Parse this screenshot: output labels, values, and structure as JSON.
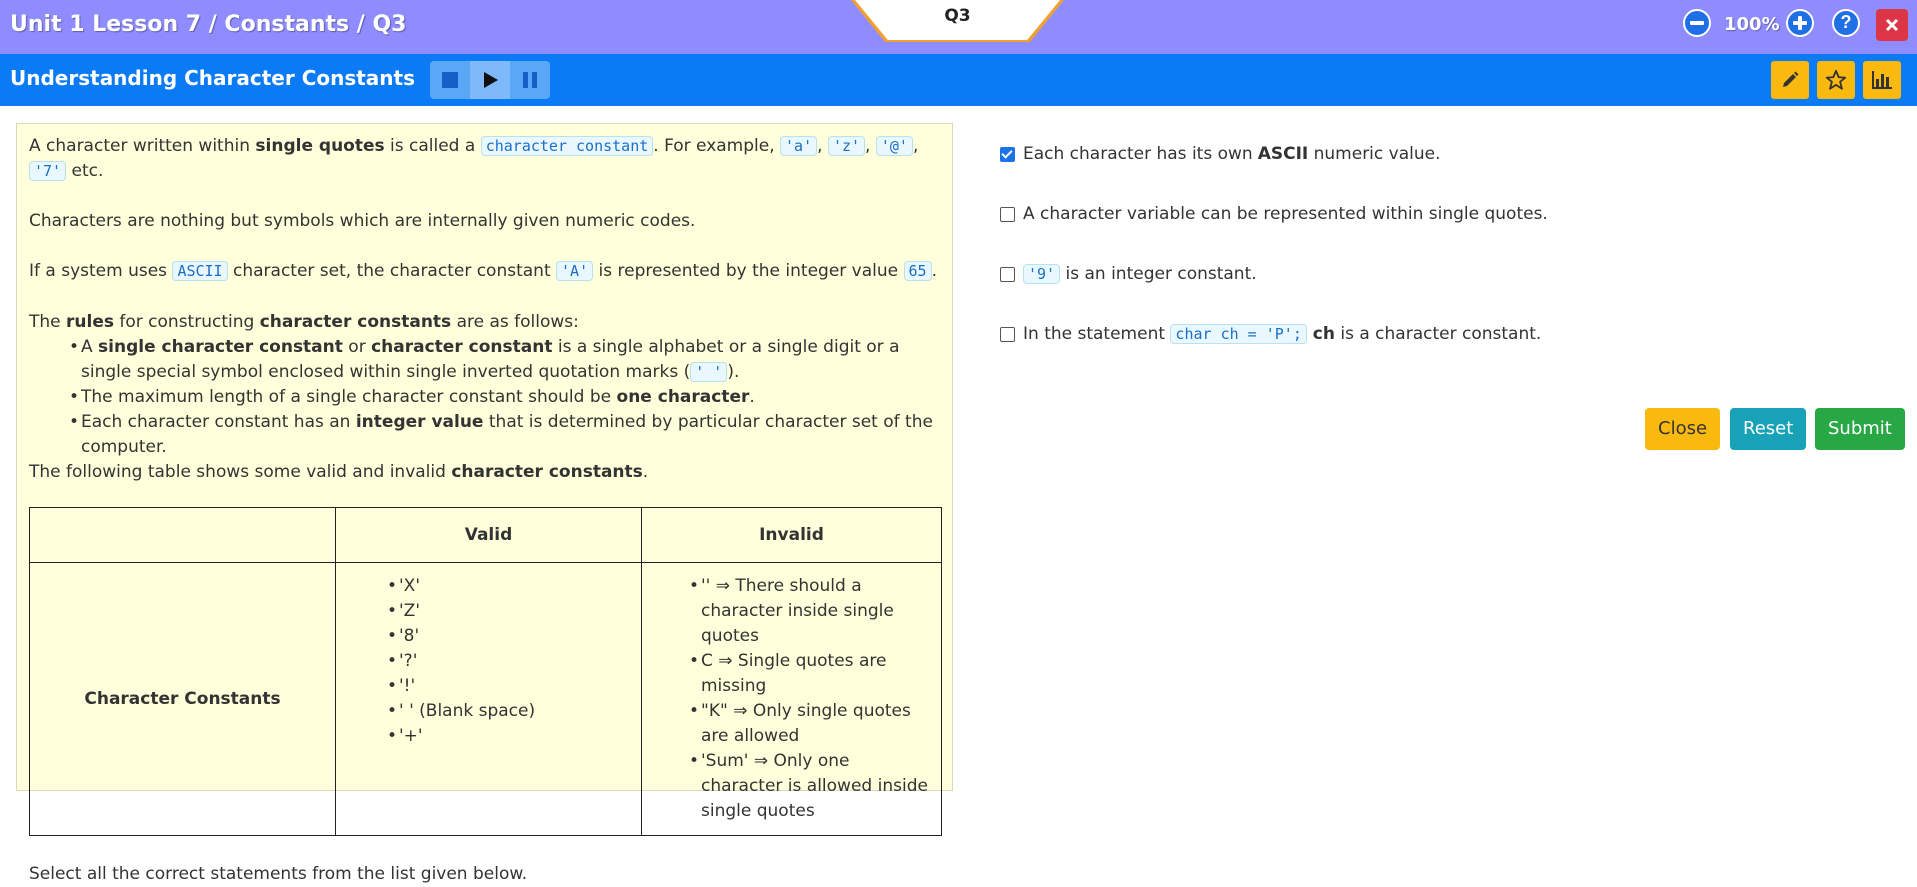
{
  "header": {
    "breadcrumb": "Unit 1 Lesson 7 / Constants / Q3",
    "question_tab": "Q3",
    "zoom_level": "100%",
    "zoom_out_icon": "minus-circle-icon",
    "zoom_in_icon": "plus-circle-icon",
    "help_icon": "question-icon",
    "close_icon": "close-icon"
  },
  "titlebar": {
    "title": "Understanding Character Constants",
    "media_controls": [
      "stop-icon",
      "play-icon",
      "pause-icon"
    ],
    "tools": [
      "pencil-icon",
      "star-icon",
      "bar-chart-icon"
    ],
    "accent": "#0a7af5",
    "tool_color": "#f9b90f"
  },
  "content": {
    "p1": {
      "a": "A character written within ",
      "b": "single quotes",
      "c": " is called a ",
      "code1": "character constant",
      "d": ". For example, ",
      "ex1": "'a'",
      "sep1": ", ",
      "ex2": "'z'",
      "sep2": ", ",
      "ex3": "'@'",
      "sep3": ", ",
      "ex4": "'7'",
      "e": " etc."
    },
    "p2": "Characters are nothing but symbols which are internally given numeric codes.",
    "p3": {
      "a": "If a system uses ",
      "code1": "ASCII",
      "b": " character set, the character constant ",
      "code2": "'A'",
      "c": " is represented by the integer value ",
      "code3": "65",
      "d": "."
    },
    "p4": {
      "a": "The ",
      "b": "rules",
      "c": " for constructing ",
      "d": "character constants",
      "e": " are as follows:"
    },
    "rule1": {
      "a": "A ",
      "b": "single character constant",
      "c": " or ",
      "d": "character constant",
      "e": " is a single alphabet or a single digit or a single special symbol enclosed within single inverted quotation marks (",
      "code": "' '",
      "f": ")."
    },
    "rule2": {
      "a": "The maximum length of a single character constant should be ",
      "b": "one character",
      "c": "."
    },
    "rule3": {
      "a": "Each character constant has an ",
      "b": "integer value",
      "c": " that is determined by particular character set of the computer."
    },
    "p5": {
      "a": "The following table shows some valid and invalid ",
      "b": "character constants",
      "c": "."
    },
    "table": {
      "headers": [
        "",
        "Valid",
        "Invalid"
      ],
      "row_label": "Character Constants",
      "valid": [
        "'X'",
        "'Z'",
        "'8'",
        "'?'",
        "'!'",
        "' ' (Blank space)",
        "'+'"
      ],
      "invalid": [
        "'' ⇒ There should a character inside single quotes",
        "C ⇒ Single quotes are missing",
        "\"K\" ⇒ Only single quotes are allowed",
        "'Sum' ⇒ Only one character is allowed inside single quotes"
      ]
    },
    "instruction": "Select all the correct statements from the list given below."
  },
  "options": [
    {
      "checked": true,
      "a": "Each character has its own ",
      "b": "ASCII",
      "c": " numeric value."
    },
    {
      "checked": false,
      "text": "A character variable can be represented within single quotes."
    },
    {
      "checked": false,
      "code": "'9'",
      "text": " is an integer constant."
    },
    {
      "checked": false,
      "a": "In the statement ",
      "code": "char ch = 'P';",
      "b": " ch",
      "c": " is a character constant."
    }
  ],
  "buttons": {
    "close": "Close",
    "reset": "Reset",
    "submit": "Submit",
    "close_color": "#f9b90f",
    "reset_color": "#17a2b8",
    "submit_color": "#28a745"
  }
}
